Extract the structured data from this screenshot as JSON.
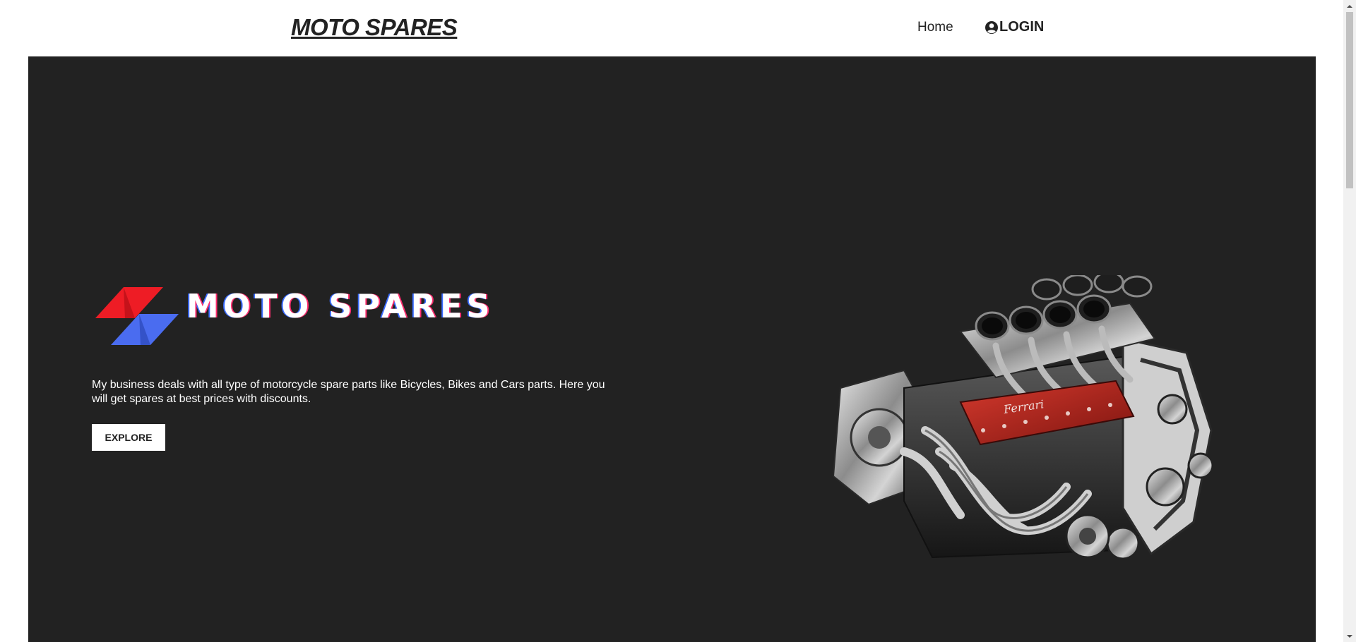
{
  "header": {
    "brand": "MOTO SPARES",
    "nav": {
      "home": "Home",
      "login": "LOGIN"
    }
  },
  "hero": {
    "logo_text": "MOTO SPARES",
    "description": "My business deals with all type of motorcycle spare parts like Bicycles, Bikes and Cars parts. Here you will get spares at best prices with discounts.",
    "explore_label": "EXPLORE",
    "engine_badge": "Ferrari"
  },
  "colors": {
    "hero_background": "#222222",
    "logo_red": "#ee1c25",
    "logo_blue": "#4a6cf0",
    "engine_red": "#b3261e"
  },
  "icons": [
    "user-circle-icon",
    "chevron-up-icon",
    "chevron-down-icon"
  ]
}
